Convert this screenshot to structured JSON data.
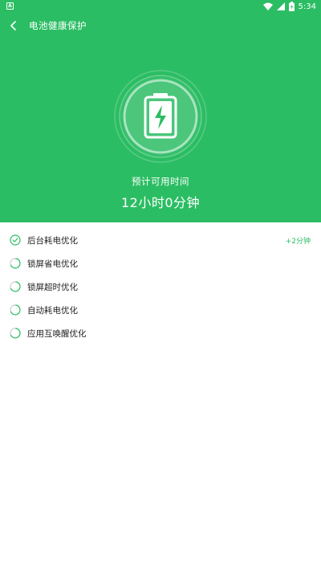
{
  "status_bar": {
    "left_badge": "A",
    "time": "5:34",
    "icons": [
      "wifi-icon",
      "signal-icon",
      "battery-icon"
    ]
  },
  "header": {
    "back_icon": "chevron-left-icon",
    "title": "电池健康保护"
  },
  "estimate": {
    "label": "预计可用时间",
    "value": "12小时0分钟"
  },
  "optimizations": [
    {
      "label": "后台耗电优化",
      "status": "done",
      "extra": "+2分钟",
      "icon": "check-circle-icon"
    },
    {
      "label": "锁屏省电优化",
      "status": "running",
      "extra": "",
      "icon": "spinner-icon"
    },
    {
      "label": "锁屏超时优化",
      "status": "running",
      "extra": "",
      "icon": "spinner-icon"
    },
    {
      "label": "自动耗电优化",
      "status": "running",
      "extra": "",
      "icon": "spinner-icon"
    },
    {
      "label": "应用互唤醒优化",
      "status": "running",
      "extra": "",
      "icon": "spinner-icon"
    }
  ],
  "colors": {
    "accent": "#2bbd63",
    "text": "#222222",
    "background": "#ffffff"
  }
}
